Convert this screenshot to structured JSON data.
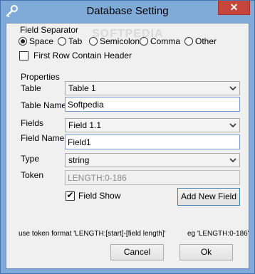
{
  "window": {
    "title": "Database Setting",
    "close_glyph": "✕",
    "app_icon": "wrench-icon"
  },
  "watermark": "SOFTPEDIA",
  "separator": {
    "group_label": "Field Separator",
    "options": [
      {
        "label": "Space",
        "selected": true
      },
      {
        "label": "Tab",
        "selected": false
      },
      {
        "label": "Semicolon",
        "selected": false
      },
      {
        "label": "Comma",
        "selected": false
      },
      {
        "label": "Other",
        "selected": false
      }
    ],
    "first_row_label": "First Row Contain Header",
    "first_row_checked": false
  },
  "properties": {
    "heading": "Properties",
    "table_label": "Table",
    "table_value": "Table 1",
    "table_name_label": "Table Name",
    "table_name_value": "Softpedia",
    "fields_label": "Fields",
    "fields_value": "Field 1.1",
    "field_name_label": "Field Name",
    "field_name_value": "Field1",
    "type_label": "Type",
    "type_value": "string",
    "token_label": "Token",
    "token_value": "LENGTH:0-186",
    "field_show_label": "Field Show",
    "field_show_checked": true,
    "add_field_button": "Add New Field"
  },
  "hint": {
    "format": "use token format 'LENGTH:[start]-[field length]'",
    "example": "eg 'LENGTH:0-186'"
  },
  "buttons": {
    "cancel": "Cancel",
    "ok": "Ok"
  },
  "colors": {
    "frame": "#80abd9",
    "close": "#c7453a",
    "client": "#f0f0f0"
  }
}
